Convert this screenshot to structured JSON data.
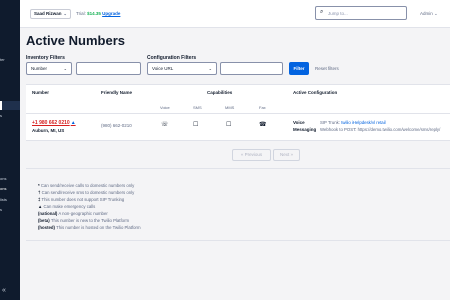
{
  "sidebar": {
    "items": [
      "ter",
      "s",
      "ons",
      "ons",
      "lists",
      "s"
    ],
    "collapse_icon": "«"
  },
  "topbar": {
    "account": "Saad Rizwan",
    "trial_prefix": "Trial:",
    "trial_amount": "$14.35",
    "upgrade": "Upgrade",
    "search_placeholder": "Jump to...",
    "search_icon": "⌕",
    "admin": "Admin"
  },
  "page": {
    "title": "Active Numbers"
  },
  "filters": {
    "inventory_label": "Inventory Filters",
    "inventory_select": "Number",
    "configuration_label": "Configuration Filters",
    "configuration_select": "Voice URL",
    "filter_button": "Filter",
    "reset_link": "Reset filters"
  },
  "table": {
    "headers": {
      "number": "Number",
      "friendly_name": "Friendly Name",
      "capabilities": "Capabilities",
      "active_configuration": "Active Configuration"
    },
    "capability_headers": [
      "Voice",
      "SMS",
      "MMS",
      "Fax"
    ],
    "rows": [
      {
        "number": "+1 980 662 0210",
        "trial_mark": "▲",
        "location": "Auburn, MI, US",
        "friendly_name": "(980) 662-0210",
        "capability_icons": [
          "☏",
          "☐",
          "☐",
          "☎"
        ],
        "config_type": "Voice",
        "config_type2": "Messaging",
        "sip_prefix": "SIP Trunk:",
        "sip_link": "twilio iHelpdesk/vl retail",
        "webhook": "Webhook to POST: https://demo.twilio.com/welcome/sms/reply/"
      }
    ]
  },
  "pager": {
    "previous": "« Previous",
    "next": "Next »"
  },
  "legend": [
    {
      "mark": "*",
      "text": "Can send/receive calls to domestic numbers only"
    },
    {
      "mark": "†",
      "text": "Can send/receive sms to domestic numbers only"
    },
    {
      "mark": "‡",
      "text": "This number does not support SIP Trunking"
    },
    {
      "mark": "▲",
      "text": "Can make emergency calls"
    },
    {
      "mark": "(national)",
      "text": "A non-geographic number"
    },
    {
      "mark": "(beta)",
      "text": "This number is new to the Twilio Platform"
    },
    {
      "mark": "(hosted)",
      "text": "This number is hosted on the Twilio Platform"
    }
  ],
  "colors": {
    "primary": "#0263e0",
    "danger": "#d61f1f",
    "success": "#14b053",
    "sidebar": "#0f1b2d"
  }
}
